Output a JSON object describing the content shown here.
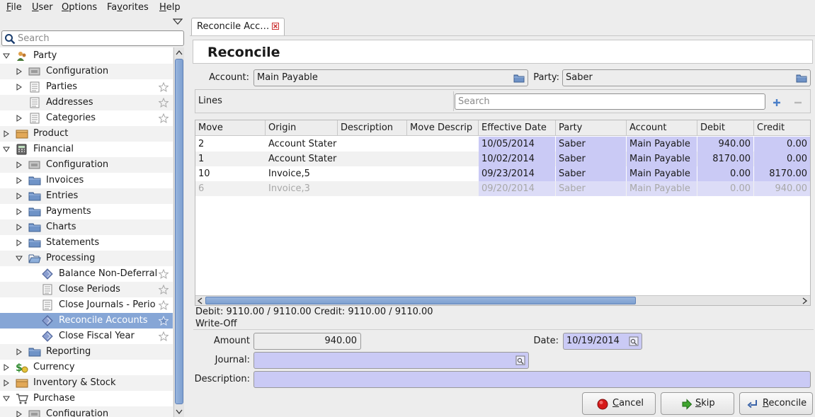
{
  "menubar": {
    "items": [
      {
        "mnemonic": "F",
        "rest": "ile"
      },
      {
        "mnemonic": "U",
        "rest": "ser"
      },
      {
        "mnemonic": "O",
        "rest": "ptions"
      },
      {
        "mnemonic": "",
        "pre": "Fa",
        "mn2": "v",
        "rest": "orites"
      },
      {
        "mnemonic": "H",
        "rest": "elp"
      }
    ]
  },
  "sidebar": {
    "search_placeholder": "Search",
    "items": [
      {
        "label": "Party",
        "icon": "party-icon",
        "expanded": true,
        "favorite": false
      },
      {
        "label": "Configuration",
        "icon": "configuration-icon",
        "expanded": false,
        "favorite": false
      },
      {
        "label": "Parties",
        "icon": "list-icon",
        "expanded": false,
        "favorite": true
      },
      {
        "label": "Addresses",
        "icon": "list-icon",
        "favorite": true
      },
      {
        "label": "Categories",
        "icon": "list-icon",
        "expanded": false,
        "favorite": true
      },
      {
        "label": "Product",
        "icon": "product-icon",
        "expanded": false
      },
      {
        "label": "Financial",
        "icon": "financial-icon",
        "expanded": true
      },
      {
        "label": "Configuration",
        "icon": "configuration-icon",
        "expanded": false
      },
      {
        "label": "Invoices",
        "icon": "folder-icon",
        "expanded": false
      },
      {
        "label": "Entries",
        "icon": "folder-icon",
        "expanded": false
      },
      {
        "label": "Payments",
        "icon": "folder-icon",
        "expanded": false
      },
      {
        "label": "Charts",
        "icon": "folder-icon",
        "expanded": false
      },
      {
        "label": "Statements",
        "icon": "folder-icon",
        "expanded": false
      },
      {
        "label": "Processing",
        "icon": "folder-open-icon",
        "expanded": true
      },
      {
        "label": "Balance Non-Deferral",
        "icon": "wizard-icon",
        "favorite": true
      },
      {
        "label": "Close Periods",
        "icon": "list-icon",
        "favorite": true
      },
      {
        "label": "Close Journals - Perio",
        "icon": "list-icon",
        "favorite": true
      },
      {
        "label": "Reconcile Accounts",
        "icon": "wizard-icon",
        "favorite": true,
        "selected": true
      },
      {
        "label": "Close Fiscal Year",
        "icon": "wizard-icon",
        "favorite": true
      },
      {
        "label": "Reporting",
        "icon": "folder-icon",
        "expanded": false
      },
      {
        "label": "Currency",
        "icon": "currency-icon",
        "expanded": false
      },
      {
        "label": "Inventory & Stock",
        "icon": "stock-icon",
        "expanded": false
      },
      {
        "label": "Purchase",
        "icon": "purchase-icon",
        "expanded": true
      },
      {
        "label": "Configuration",
        "icon": "configuration-icon",
        "expanded": false
      }
    ]
  },
  "tab": {
    "label": "Reconcile Acc…"
  },
  "form": {
    "title": "Reconcile",
    "account_label": "Account:",
    "account_value": "Main Payable",
    "party_label": "Party:",
    "party_value": "Saber",
    "lines_label": "Lines",
    "lines_search_placeholder": "Search"
  },
  "grid": {
    "columns": [
      "Move",
      "Origin",
      "Description",
      "Move Descrip",
      "Effective Date",
      "Party",
      "Account",
      "Debit",
      "Credit"
    ],
    "rows": [
      {
        "move": "2",
        "origin": "Account Stater",
        "description": "",
        "move_description": "",
        "date": "10/05/2014",
        "party": "Saber",
        "account": "Main Payable",
        "debit": "940.00",
        "credit": "0.00",
        "dim": false
      },
      {
        "move": "1",
        "origin": "Account Stater",
        "description": "",
        "move_description": "",
        "date": "10/02/2014",
        "party": "Saber",
        "account": "Main Payable",
        "debit": "8170.00",
        "credit": "0.00",
        "dim": false
      },
      {
        "move": "10",
        "origin": "Invoice,5",
        "description": "",
        "move_description": "",
        "date": "09/23/2014",
        "party": "Saber",
        "account": "Main Payable",
        "debit": "0.00",
        "credit": "8170.00",
        "dim": false
      },
      {
        "move": "6",
        "origin": "Invoice,3",
        "description": "",
        "move_description": "",
        "date": "09/20/2014",
        "party": "Saber",
        "account": "Main Payable",
        "debit": "0.00",
        "credit": "940.00",
        "dim": true
      }
    ]
  },
  "totals": "Debit: 9110.00 / 9110.00 Credit: 9110.00 / 9110.00",
  "writeoff": {
    "section_label": "Write-Off",
    "amount_label": "Amount",
    "amount_value": "940.00",
    "date_label": "Date:",
    "date_value": "10/19/2014",
    "journal_label": "Journal:",
    "journal_value": "",
    "description_label": "Description:",
    "description_value": ""
  },
  "buttons": {
    "cancel": {
      "mnemonic": "C",
      "rest": "ancel"
    },
    "skip": {
      "mnemonic": "S",
      "rest": "kip"
    },
    "reconcile": {
      "mnemonic": "R",
      "rest": "econcile"
    }
  },
  "colors": {
    "selection": "#86a6d6",
    "required_field": "#cacaf5",
    "scroll_thumb": "#7ea0d0"
  }
}
